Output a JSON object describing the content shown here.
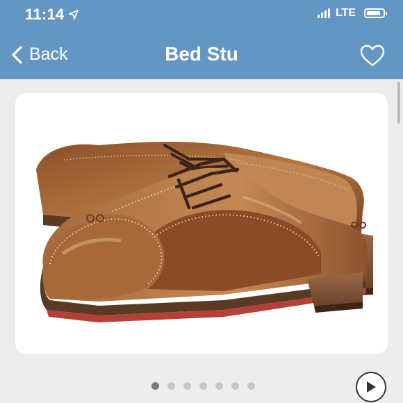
{
  "status_bar": {
    "time": "11:14",
    "network": "LTE",
    "location_icon": "location-arrow-icon",
    "battery_level": 0.85
  },
  "nav": {
    "back_label": "Back",
    "title": "Bed Stu",
    "back_icon": "chevron-left-icon",
    "favorite_icon": "heart-outline-icon"
  },
  "gallery": {
    "image_description_icon": "product-photo",
    "page_count": 7,
    "current_index": 0,
    "play_icon": "play-icon"
  },
  "colors": {
    "header": "#6496c4",
    "background": "#ededed",
    "leather": "#a8683a"
  }
}
